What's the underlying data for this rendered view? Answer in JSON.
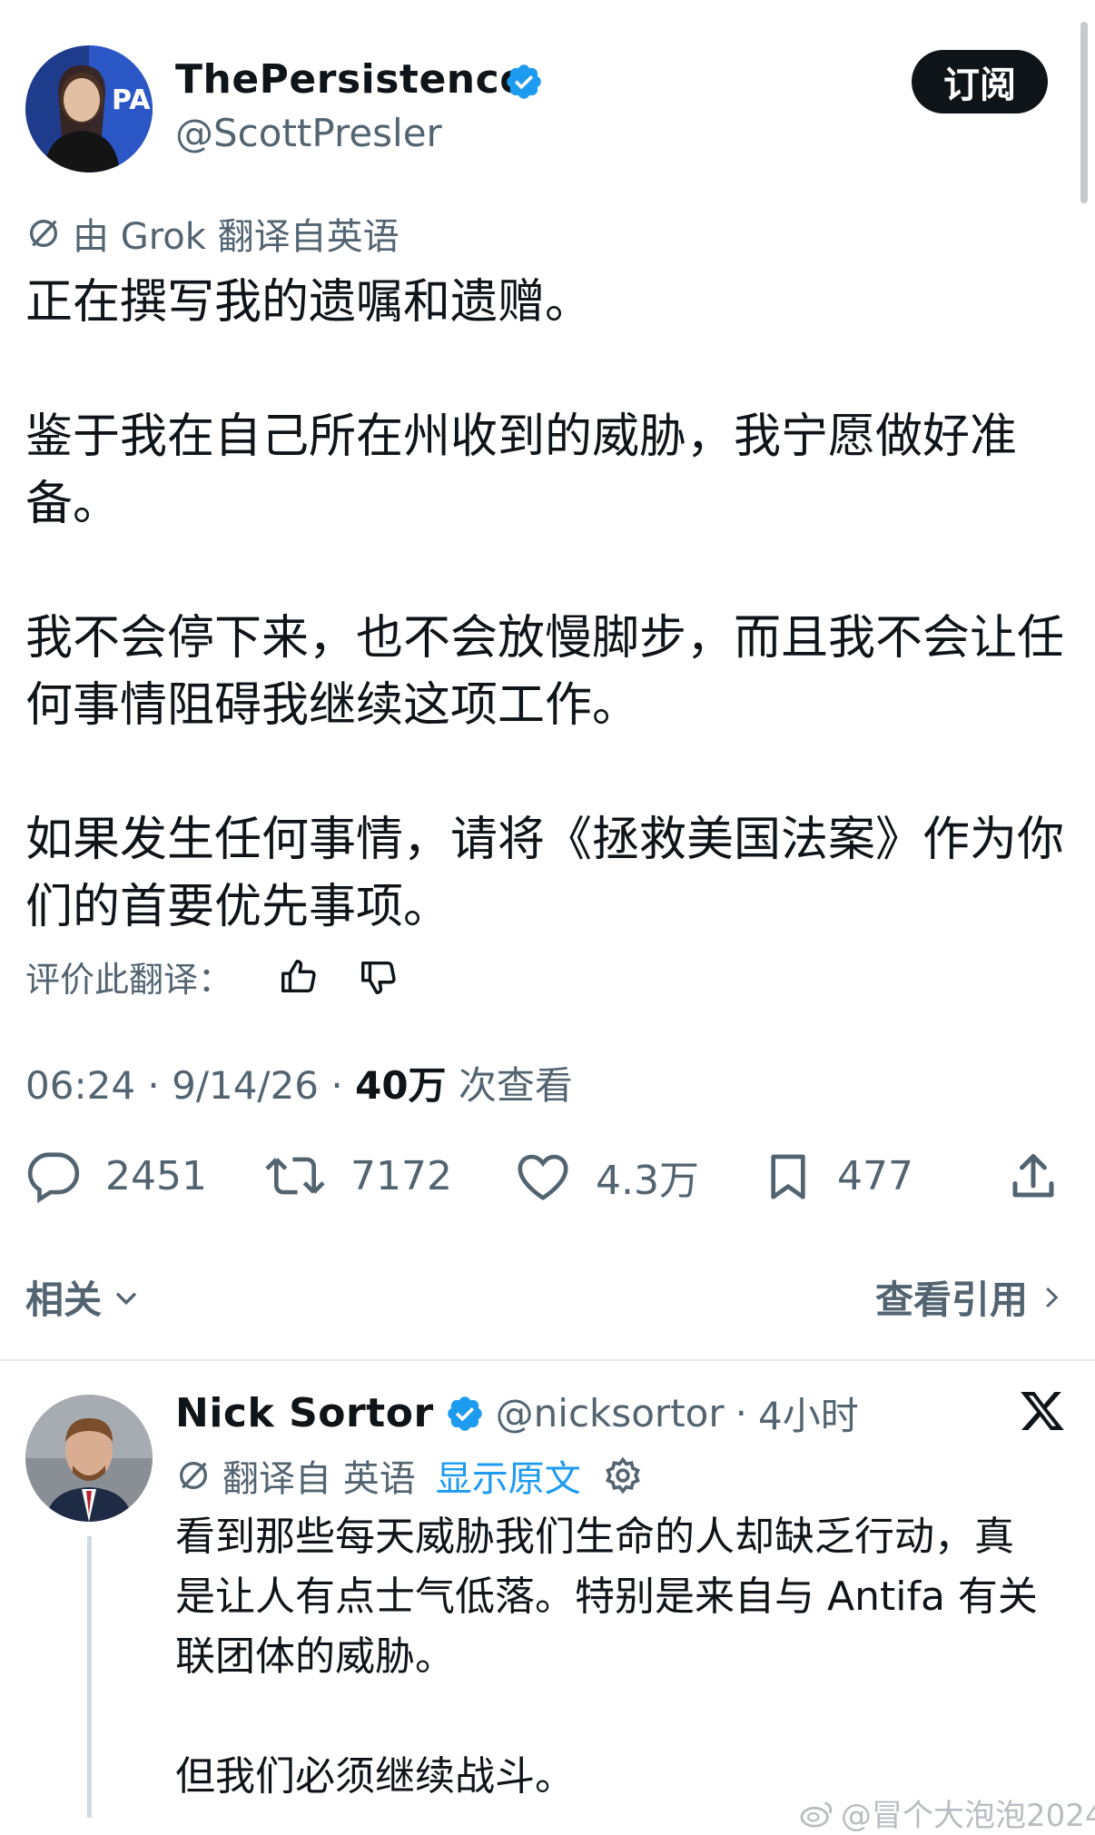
{
  "tweet": {
    "author_name": "ThePersistence",
    "author_handle": "@ScottPresler",
    "subscribe_label": "订阅",
    "translation_notice": "由 Grok 翻译自英语",
    "paragraphs": [
      "正在撰写我的遗嘱和遗赠。",
      "鉴于我在自己所在州收到的威胁，我宁愿做好准备。",
      "我不会停下来，也不会放慢脚步，而且我不会让任何事情阻碍我继续这项工作。",
      "如果发生任何事情，请将《拯救美国法案》作为你们的首要优先事项。"
    ],
    "rate_label": "评价此翻译：",
    "time": "06:24",
    "date": "9/14/26",
    "views_count": "40万",
    "views_label": "次查看",
    "replies": "2451",
    "retweets": "7172",
    "likes": "4.3万",
    "bookmarks": "477"
  },
  "related": {
    "label": "相关",
    "quotes_label": "查看引用"
  },
  "reply": {
    "author_name": "Nick Sortor",
    "author_handle": "@nicksortor",
    "time": "4小时",
    "translated_from": "翻译自 英语",
    "show_original": "显示原文",
    "paragraphs": [
      "看到那些每天威胁我们生命的人却缺乏行动，真是让人有点士气低落。特别是来自与 Antifa 有关联团体的威胁。",
      "但我们必须继续战斗。"
    ]
  },
  "watermark": "@冒个大泡泡2024",
  "colors": {
    "text": "#0f1419",
    "secondary": "#536471",
    "link": "#1d9bf0",
    "verified": "#1d9bf0"
  }
}
